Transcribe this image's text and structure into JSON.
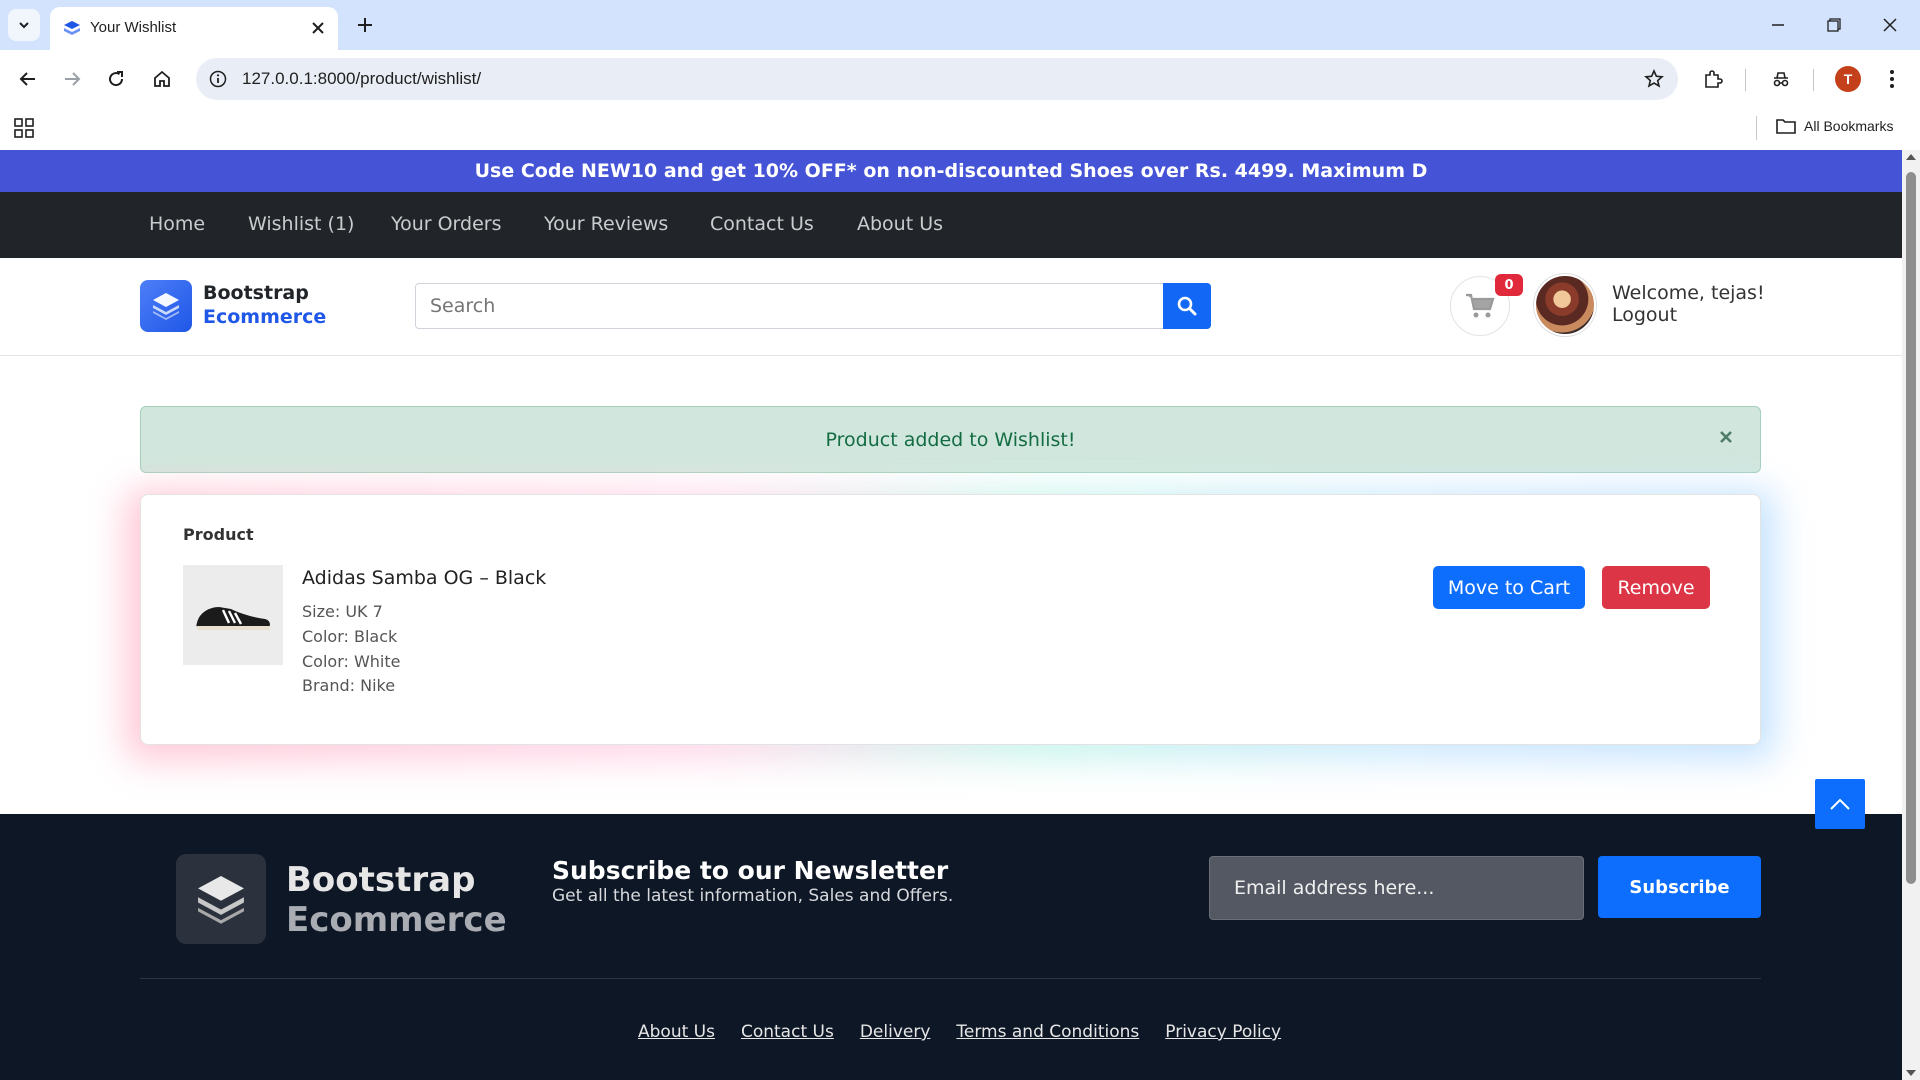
{
  "browser": {
    "tab_title": "Your Wishlist",
    "url": "127.0.0.1:8000/product/wishlist/",
    "profile_initial": "T",
    "bookmarks_label": "All Bookmarks"
  },
  "promo_text": "Use Code NEW10 and get 10% OFF* on non-discounted Shoes over Rs. 4499. Maximum D",
  "nav": {
    "items": [
      "Home",
      "Wishlist (1)",
      "Your Orders",
      "Your Reviews",
      "Contact Us",
      "About Us"
    ]
  },
  "header": {
    "logo_line1": "Bootstrap",
    "logo_line2": "Ecommerce",
    "search_placeholder": "Search",
    "cart_count": "0",
    "welcome": "Welcome, tejas!",
    "logout": "Logout"
  },
  "alert": {
    "message": "Product added to Wishlist!"
  },
  "wishlist": {
    "column_header": "Product",
    "item": {
      "name": "Adidas Samba OG – Black",
      "specs": [
        "Size: UK 7",
        "Color: Black",
        "Color: White",
        "Brand: Nike"
      ],
      "move_to_cart": "Move to Cart",
      "remove": "Remove"
    }
  },
  "footer": {
    "logo_line1": "Bootstrap",
    "logo_line2": "Ecommerce",
    "newsletter_title": "Subscribe to our Newsletter",
    "newsletter_sub": "Get all the latest information, Sales and Offers.",
    "email_placeholder": "Email address here...",
    "subscribe_label": "Subscribe",
    "links": [
      "About Us",
      "Contact Us",
      "Delivery",
      "Terms and Conditions",
      "Privacy Policy"
    ]
  },
  "colors": {
    "promo_bg": "#4553d6",
    "navbar_bg": "#212529",
    "primary": "#0d6efd",
    "danger": "#dc3545",
    "footer_bg": "#0e1726",
    "alert_bg": "#d1e7dd"
  }
}
